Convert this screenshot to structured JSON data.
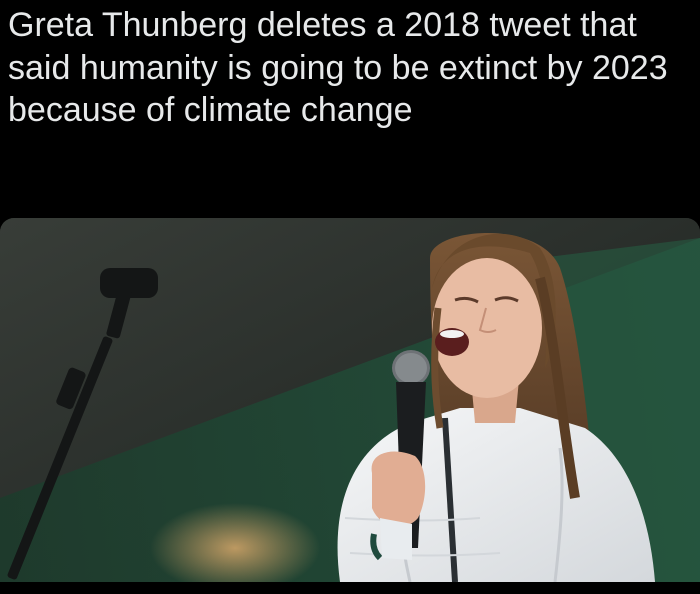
{
  "post": {
    "text": "Greta Thunberg deletes a 2018 tweet that said humanity is going to be extinct by 2023 because of climate change"
  },
  "media": {
    "alt": "",
    "colors": {
      "background_dark": "#262a26",
      "background_green": "#1f4a36",
      "jacket_white": "#eef0f2",
      "hair_brown": "#6b4a2e",
      "skin": "#e7b9a0",
      "microphone": "#1a1c1e"
    }
  }
}
